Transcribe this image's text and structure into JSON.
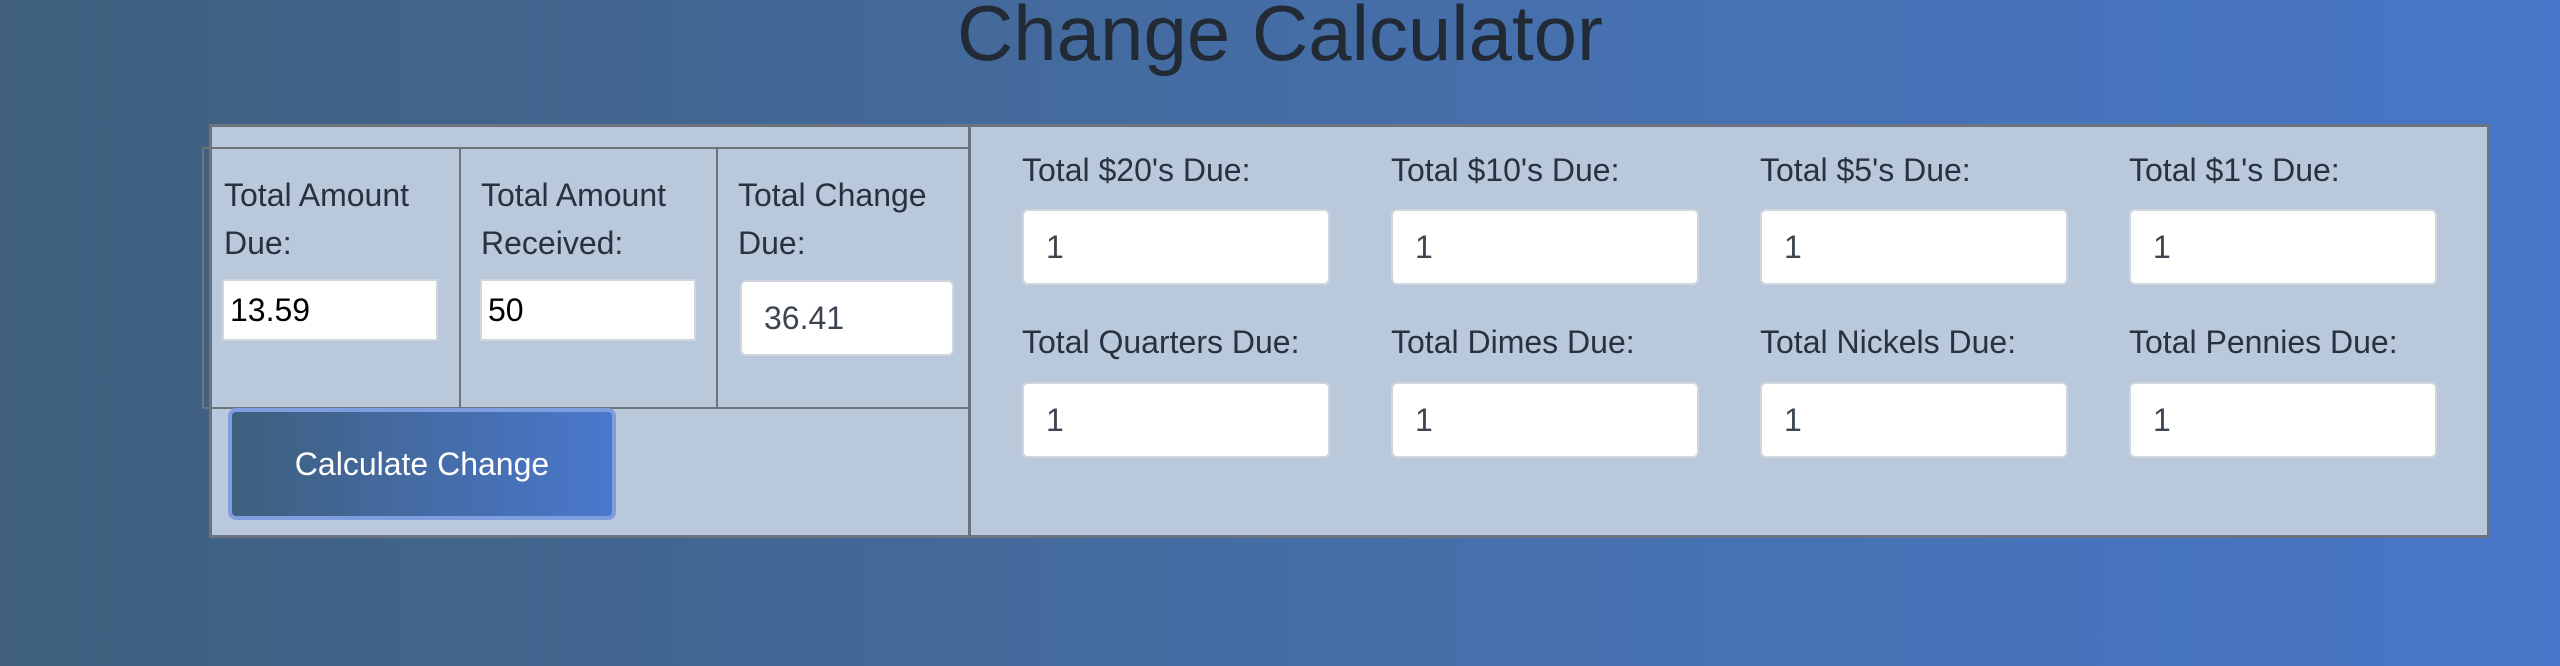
{
  "page": {
    "title": "Change Calculator"
  },
  "inputs": {
    "amount_due": {
      "label_line1": "Total Amount",
      "label_line2": "Due:",
      "value": "13.59"
    },
    "amount_received": {
      "label_line1": "Total Amount",
      "label_line2": "Received:",
      "value": "50"
    },
    "change_due": {
      "label_line1": "Total Change",
      "label_line2": "Due:",
      "value": "36.41"
    }
  },
  "calculate_button": {
    "label": "Calculate Change"
  },
  "breakdown": [
    {
      "label": "Total $20's Due:",
      "value": "1"
    },
    {
      "label": "Total $10's Due:",
      "value": "1"
    },
    {
      "label": "Total $5's Due:",
      "value": "1"
    },
    {
      "label": "Total $1's Due:",
      "value": "1"
    },
    {
      "label": "Total Quarters Due:",
      "value": "1"
    },
    {
      "label": "Total Dimes Due:",
      "value": "1"
    },
    {
      "label": "Total Nickels Due:",
      "value": "1"
    },
    {
      "label": "Total Pennies Due:",
      "value": "1"
    }
  ]
}
